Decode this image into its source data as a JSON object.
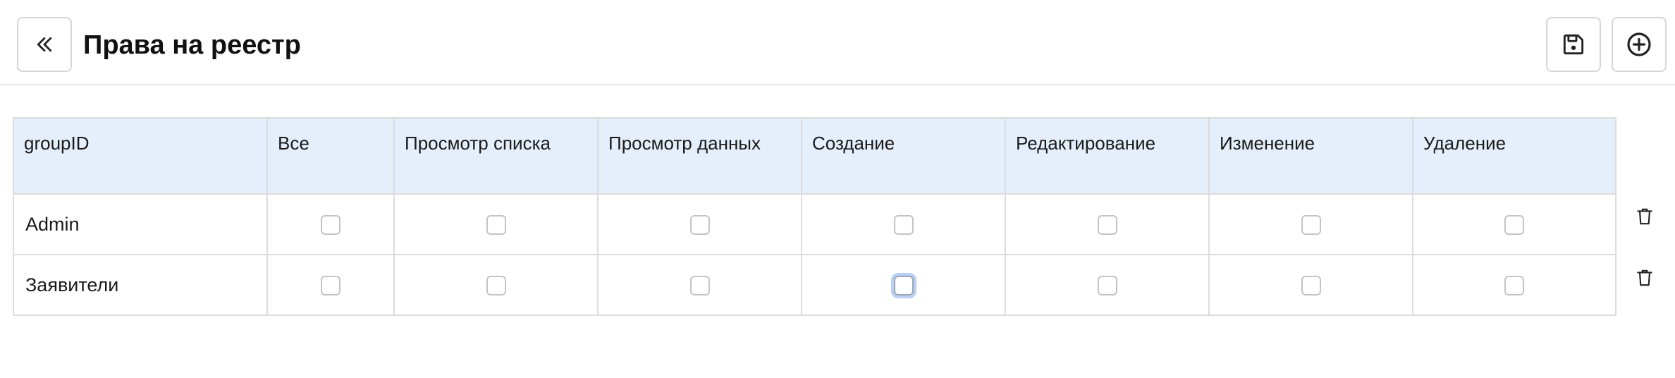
{
  "header": {
    "title": "Права на реестр",
    "back_icon": "double-chevron-left-icon",
    "save_icon": "floppy-disk-icon",
    "add_icon": "plus-circle-icon"
  },
  "table": {
    "columns": [
      "groupID",
      "Все",
      "Просмотр списка",
      "Просмотр данных",
      "Создание",
      "Редактирование",
      "Изменение",
      "Удаление"
    ],
    "rows": [
      {
        "group": "Admin",
        "permissions": [
          false,
          false,
          false,
          false,
          false,
          false,
          false
        ],
        "delete_icon": "trash-icon"
      },
      {
        "group": "Заявители",
        "permissions": [
          false,
          false,
          false,
          false,
          false,
          false,
          false
        ],
        "delete_icon": "trash-icon",
        "focused_permission": "Создание"
      }
    ]
  },
  "colors": {
    "header_background": "#e5eefb",
    "focus_ring": "#b9d0f2",
    "border": "#dcdcdc"
  }
}
